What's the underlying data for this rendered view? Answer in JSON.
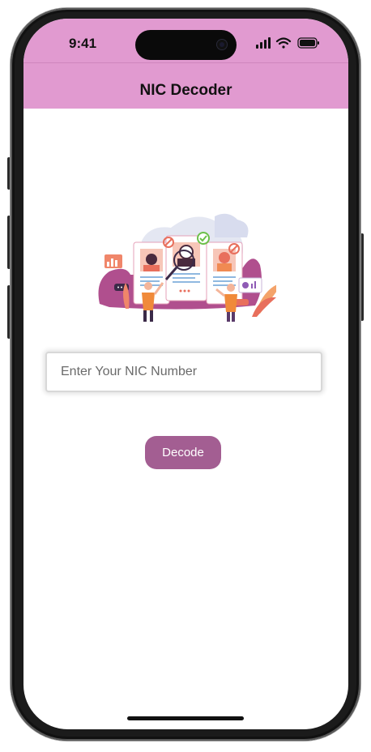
{
  "status_bar": {
    "time": "9:41",
    "icons": [
      "signal-icon",
      "wifi-icon",
      "battery-icon"
    ]
  },
  "app_bar": {
    "title": "NIC Decoder",
    "color": "#e19ad0"
  },
  "illustration": {
    "icon": "id-verification-illustration"
  },
  "nic_input": {
    "placeholder": "Enter Your NIC Number",
    "value": ""
  },
  "decode_button": {
    "label": "Decode",
    "color": "#a35e92"
  }
}
